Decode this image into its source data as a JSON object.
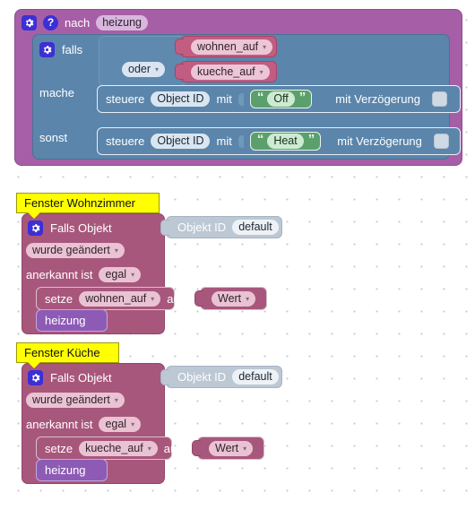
{
  "canvas": {
    "background": "#ffffff",
    "grid_dot_color": "#c9c9d4",
    "grid_spacing_px": 25
  },
  "palette": {
    "function_purple": "#a65fa6",
    "control_blue": "#5b85ab",
    "trigger_maroon": "#a8577c",
    "variable_pink": "#c05d80",
    "text_green": "#5ba06c",
    "object_steel": "#bcc8d4",
    "call_violet": "#8d5bb5",
    "comment_yellow": "#ffff00",
    "icon_blue": "#3b2fd6"
  },
  "function_block": {
    "gear_icon": "gear-icon",
    "help_icon": "help-icon",
    "keyword": "nach",
    "name": "heizung",
    "if_block": {
      "gear_icon": "gear-icon",
      "keyword": "falls",
      "operator": "oder",
      "operands": [
        "wohnen_auf",
        "kueche_auf"
      ],
      "do_label": "mache",
      "else_label": "sonst",
      "do_statement": {
        "verb": "steuere",
        "object_field": "Object ID",
        "with_label": "mit",
        "value": "Off",
        "delay_label": "mit Verzögerung",
        "delay_socket": "empty-socket"
      },
      "else_statement": {
        "verb": "steuere",
        "object_field": "Object ID",
        "with_label": "mit",
        "value": "Heat",
        "delay_label": "mit Verzögerung",
        "delay_socket": "empty-socket"
      }
    }
  },
  "triggers": [
    {
      "comment": "Fenster Wohnzimmer",
      "gear_icon": "gear-icon",
      "header": "Falls Objekt",
      "object_id_label": "Objekt ID",
      "object_id_value": "default",
      "change_type": "wurde geändert",
      "ack_label": "anerkannt ist",
      "ack_value": "egal",
      "set_verb": "setze",
      "set_variable": "wohnen_auf",
      "set_to_label": "auf",
      "set_value": "Wert",
      "call_function": "heizung"
    },
    {
      "comment": "Fenster Küche",
      "gear_icon": "gear-icon",
      "header": "Falls Objekt",
      "object_id_label": "Objekt ID",
      "object_id_value": "default",
      "change_type": "wurde geändert",
      "ack_label": "anerkannt ist",
      "ack_value": "egal",
      "set_verb": "setze",
      "set_variable": "kueche_auf",
      "set_to_label": "auf",
      "set_value": "Wert",
      "call_function": "heizung"
    }
  ],
  "glyphs": {
    "caret_down": "▾",
    "quote_open": "“",
    "quote_close": "”",
    "question_mark": "?"
  }
}
